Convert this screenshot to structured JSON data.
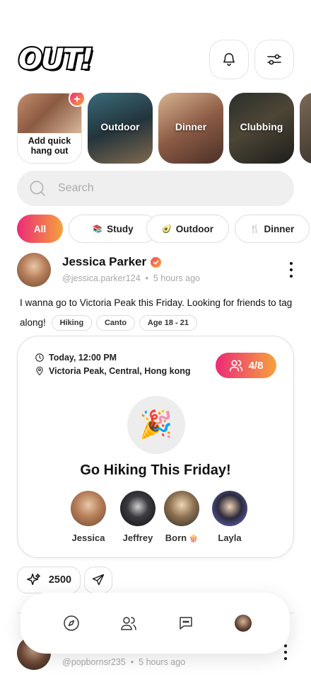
{
  "app": {
    "logo_text": "OUT!"
  },
  "header": {
    "bell_icon": "bell-icon",
    "filter_icon": "sliders-icon"
  },
  "stories": [
    {
      "label": "Add quick hang out",
      "badge": "+"
    },
    {
      "label": "Outdoor"
    },
    {
      "label": "Dinner"
    },
    {
      "label": "Clubbing"
    }
  ],
  "search": {
    "placeholder": "Search",
    "value": ""
  },
  "filters": [
    {
      "label": "All",
      "active": true
    },
    {
      "label": "Study",
      "emoji": "📚"
    },
    {
      "label": "Outdoor",
      "emoji": "🥑"
    },
    {
      "label": "Dinner",
      "emoji": "🍴"
    }
  ],
  "post": {
    "author": "Jessica Parker",
    "handle": "@jessica.parker124",
    "separator": "•",
    "time": "5 hours ago",
    "text": "I wanna go to Victoria Peak this Friday. Looking for friends to tag along!",
    "tags": [
      "Hiking",
      "Canto",
      "Age 18 - 21"
    ],
    "event": {
      "time": "Today, 12:00 PM",
      "location": "Victoria Peak, Central, Hong kong",
      "count": "4/8",
      "emoji": "🎉",
      "title": "Go Hiking This Friday!",
      "members": [
        {
          "name": "Jessica"
        },
        {
          "name": "Jeffrey"
        },
        {
          "name": "Born",
          "emoji": "🍿"
        },
        {
          "name": "Layla"
        }
      ]
    },
    "sparks": "2500"
  },
  "post2": {
    "handle": "@popbornsr235",
    "separator": "•",
    "time": "5 hours ago"
  },
  "nav": {
    "items": [
      "compass-icon",
      "friends-icon",
      "chat-icon",
      "profile-avatar"
    ]
  },
  "colors": {
    "accent_start": "#ec2a78",
    "accent_end": "#f6a23c"
  }
}
